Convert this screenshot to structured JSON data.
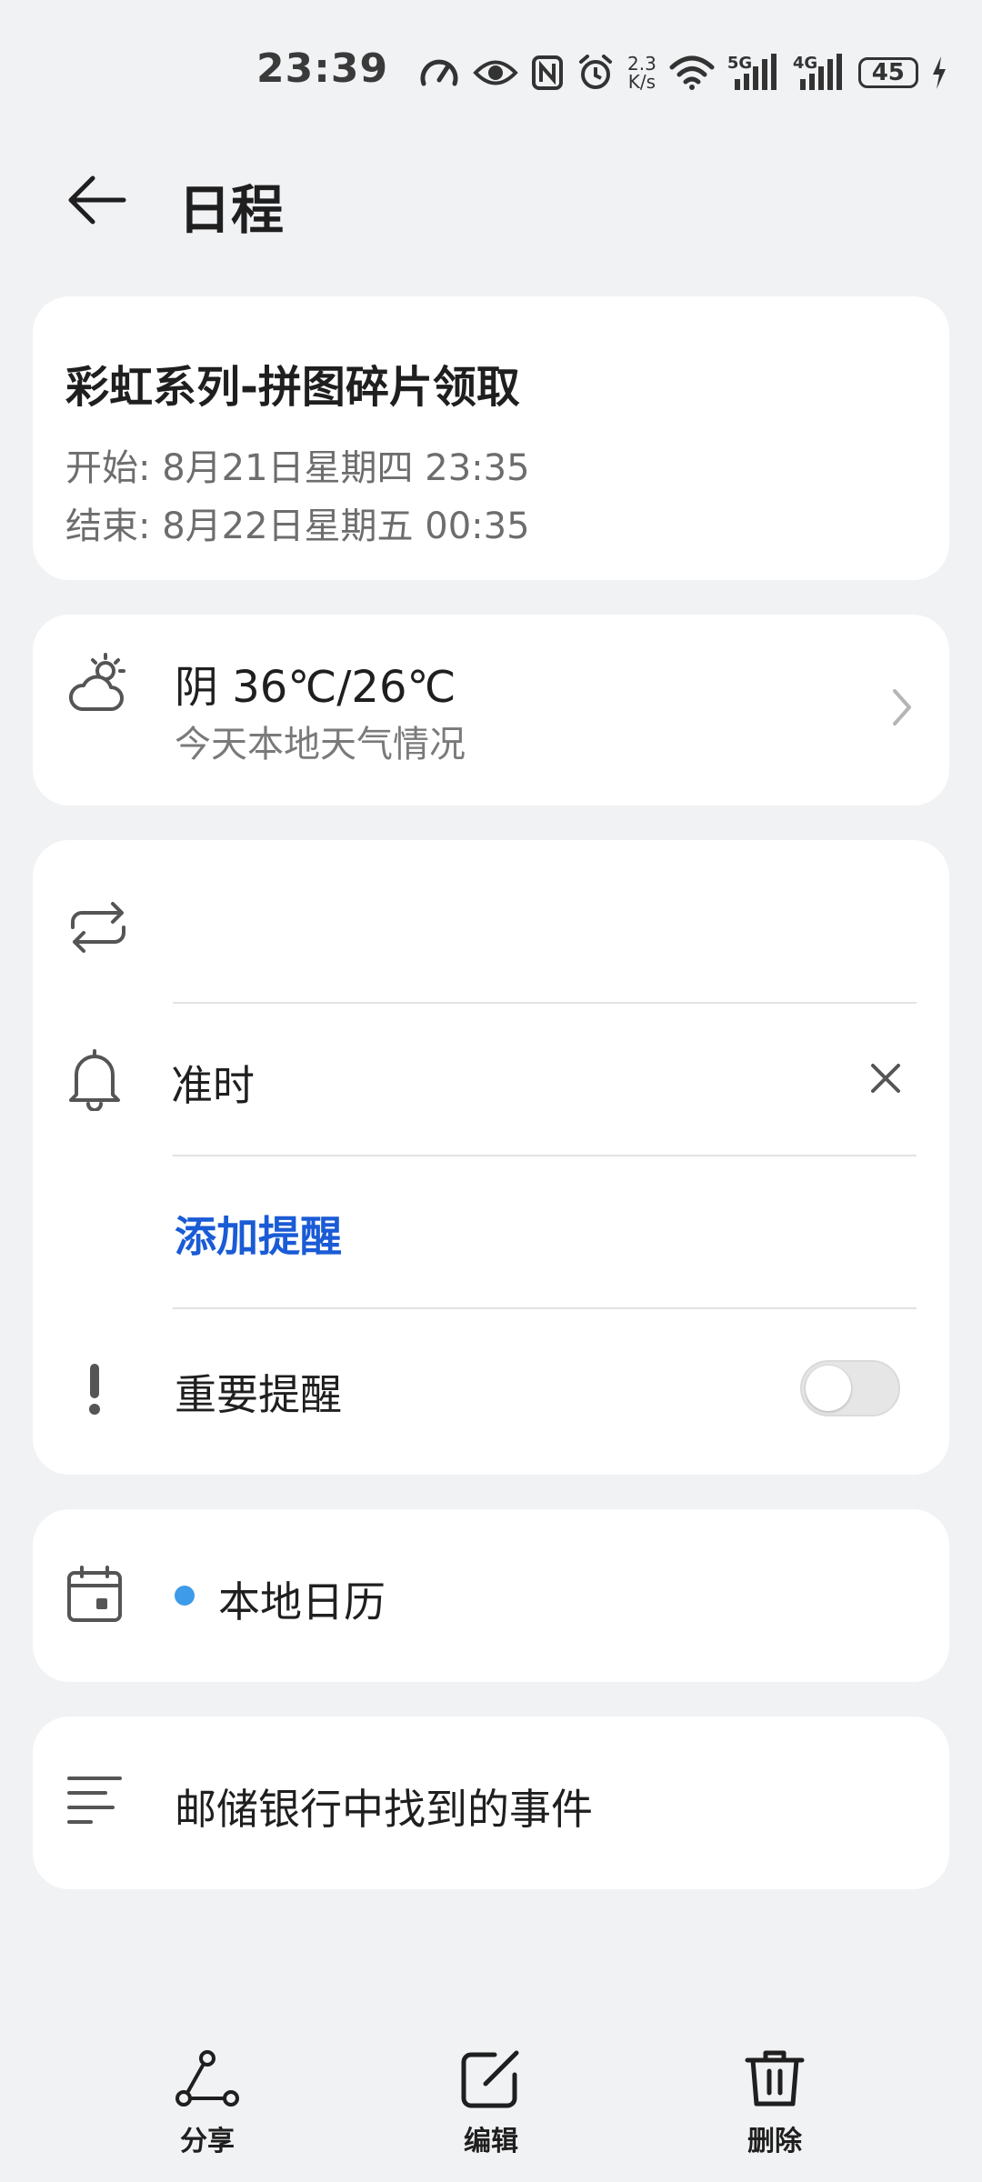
{
  "status_bar": {
    "time": "23:39",
    "net_speed_value": "2.3",
    "net_speed_unit": "K/s",
    "signal1_label": "5G",
    "signal2_label": "4G",
    "battery": "45"
  },
  "header": {
    "title": "日程"
  },
  "event": {
    "title": "彩虹系列-拼图碎片领取",
    "start": "开始:  8月21日星期四 23:35",
    "end": "结束:  8月22日星期五 00:35"
  },
  "weather": {
    "summary": "阴 36℃/26℃",
    "subtitle": "今天本地天气情况"
  },
  "reminders": {
    "timing": "准时",
    "add_label": "添加提醒",
    "important_label": "重要提醒",
    "important_on": false
  },
  "calendar": {
    "name": "本地日历",
    "dot_color": "#3d9be9"
  },
  "notes": {
    "text": "邮储银行中找到的事件"
  },
  "bottom_bar": {
    "share": "分享",
    "edit": "编辑",
    "delete": "删除"
  },
  "colors": {
    "accent": "#1a5bd6",
    "background": "#f1f2f4"
  }
}
